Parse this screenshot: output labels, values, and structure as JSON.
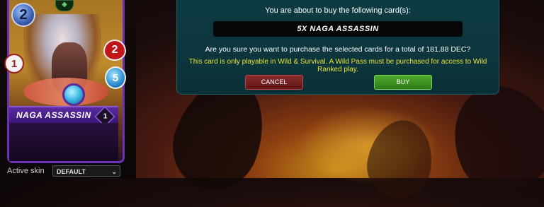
{
  "card": {
    "mana": "2",
    "name": "NAGA ASSASSIN",
    "level": "1",
    "attack": "1",
    "health": "2",
    "speed": "5"
  },
  "skin": {
    "label": "Active skin",
    "selected": "DEFAULT"
  },
  "dialog": {
    "title": "You are about to buy the following card(s):",
    "item": "5X NAGA ASSASSIN",
    "confirm_text": "Are you sure you want to purchase the selected cards for a total of 181.88 DEC?",
    "warning_text": "This card is only playable in Wild & Survival. A Wild Pass must be purchased for access to Wild Ranked play.",
    "cancel_label": "CANCEL",
    "buy_label": "BUY"
  },
  "colors": {
    "dialog_bg": "#0e3b43",
    "warning": "#e8e33a",
    "cancel": "#8a2b2b",
    "buy": "#4ea82c",
    "card_border": "#6b32b5"
  },
  "icons": [
    "mana-gem-icon",
    "health-heart-icon",
    "speed-icon",
    "attack-icon",
    "element-orb-icon",
    "chevron-down-icon"
  ]
}
